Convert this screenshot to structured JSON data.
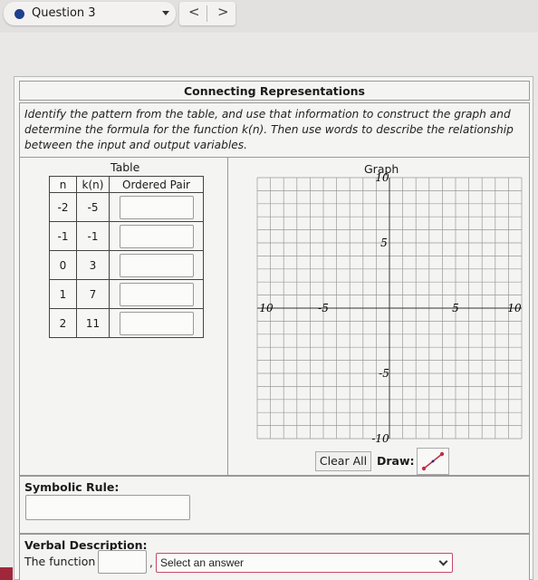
{
  "header": {
    "question_label": "Question 3",
    "prev_label": "<",
    "next_label": ">"
  },
  "panel": {
    "title": "Connecting Representations",
    "instructions": "Identify the pattern from the table, and use that information to construct the graph and determine the formula for the function k(n). Then use words to describe the relationship between the input and output variables."
  },
  "table": {
    "title": "Table",
    "headers": [
      "n",
      "k(n)",
      "Ordered Pair"
    ],
    "rows": [
      {
        "n": "-2",
        "k": "-5",
        "ordered_pair": ""
      },
      {
        "n": "-1",
        "k": "-1",
        "ordered_pair": ""
      },
      {
        "n": "0",
        "k": "3",
        "ordered_pair": ""
      },
      {
        "n": "1",
        "k": "7",
        "ordered_pair": ""
      },
      {
        "n": "2",
        "k": "11",
        "ordered_pair": ""
      }
    ]
  },
  "graph": {
    "title": "Graph",
    "xrange": [
      -10,
      10
    ],
    "yrange": [
      -10,
      10
    ],
    "tick_labels": {
      "y_top": "10",
      "y_upper": "5",
      "x_left": "10",
      "x_inner_left": "-5",
      "x_inner_right": "5",
      "x_right": "10",
      "y_lower": "-5",
      "y_bottom": "-10"
    },
    "grid": true,
    "clear_label": "Clear All",
    "draw_label": "Draw:",
    "draw_tool_icon": "line-segment-icon",
    "accent_color": "#c0304a"
  },
  "symbolic": {
    "label": "Symbolic Rule:",
    "value": ""
  },
  "verbal": {
    "label": "Verbal Description:",
    "prefix": "The function",
    "blank_value": "",
    "comma": ",",
    "select_value": "Select an answer"
  }
}
